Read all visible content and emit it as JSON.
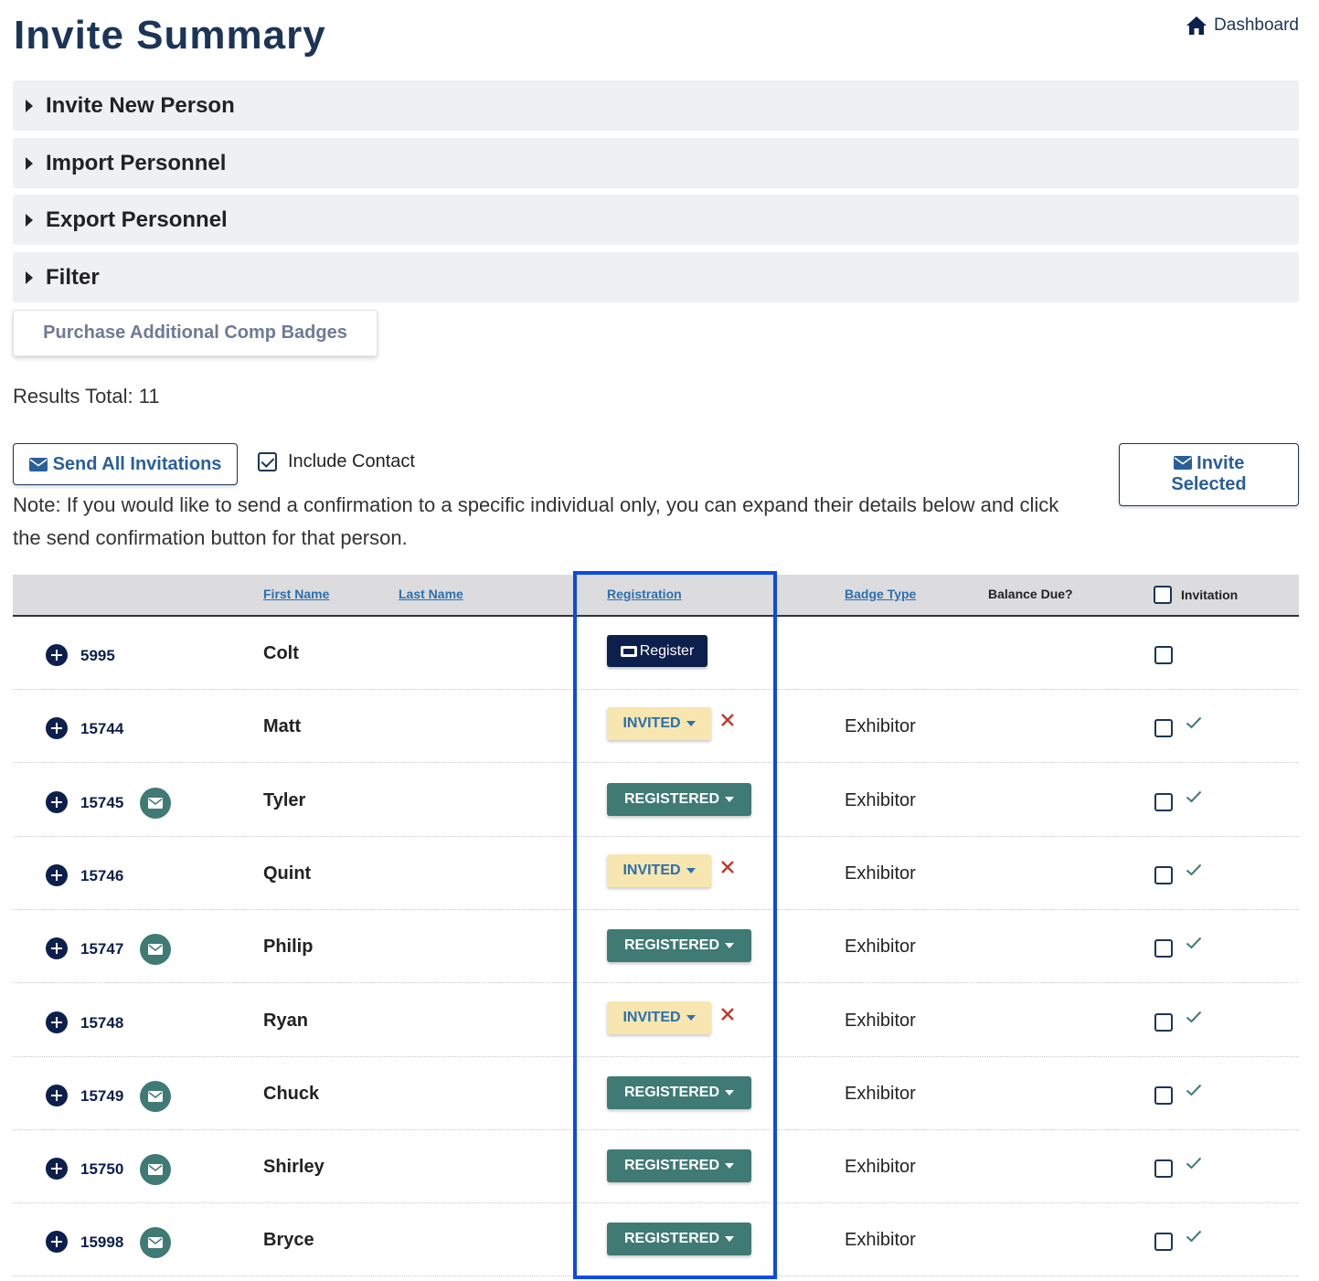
{
  "page": {
    "title": "Invite Summary"
  },
  "nav": {
    "dashboard_label": "Dashboard"
  },
  "accordions": [
    {
      "label": "Invite New Person"
    },
    {
      "label": "Import Personnel"
    },
    {
      "label": "Export Personnel"
    },
    {
      "label": "Filter"
    }
  ],
  "actions": {
    "purchase_label": "Purchase Additional Comp Badges",
    "results_label": "Results Total: 11",
    "send_all_label": "Send All Invitations",
    "include_contact_label": "Include Contact",
    "invite_selected_line1": "Invite",
    "invite_selected_line2": "Selected"
  },
  "note": "Note: If you would like to send a confirmation to a specific individual only, you can expand their details below and click the send confirmation button for that person.",
  "table": {
    "headers": {
      "first_name": "First Name",
      "last_name": "Last Name",
      "registration": "Registration",
      "badge_type": "Badge Type",
      "balance_due": "Balance Due?",
      "invitation": "Invitation"
    },
    "rows": [
      {
        "id": "5995",
        "first_name": "Colt",
        "status": "Register",
        "badge_type": "",
        "mail": false,
        "check": false
      },
      {
        "id": "15744",
        "first_name": "Matt",
        "status": "INVITED",
        "badge_type": "Exhibitor",
        "mail": false,
        "check": true
      },
      {
        "id": "15745",
        "first_name": "Tyler",
        "status": "REGISTERED",
        "badge_type": "Exhibitor",
        "mail": true,
        "check": true
      },
      {
        "id": "15746",
        "first_name": "Quint",
        "status": "INVITED",
        "badge_type": "Exhibitor",
        "mail": false,
        "check": true
      },
      {
        "id": "15747",
        "first_name": "Philip",
        "status": "REGISTERED",
        "badge_type": "Exhibitor",
        "mail": true,
        "check": true
      },
      {
        "id": "15748",
        "first_name": "Ryan",
        "status": "INVITED",
        "badge_type": "Exhibitor",
        "mail": false,
        "check": true
      },
      {
        "id": "15749",
        "first_name": "Chuck",
        "status": "REGISTERED",
        "badge_type": "Exhibitor",
        "mail": true,
        "check": true
      },
      {
        "id": "15750",
        "first_name": "Shirley",
        "status": "REGISTERED",
        "badge_type": "Exhibitor",
        "mail": true,
        "check": true
      },
      {
        "id": "15998",
        "first_name": "Bryce",
        "status": "REGISTERED",
        "badge_type": "Exhibitor",
        "mail": true,
        "check": true
      }
    ]
  },
  "colors": {
    "title": "#1c3557",
    "invited_bg": "#f8e6b0",
    "registered_bg": "#3f7a74",
    "register_bg": "#0c1f4d",
    "highlight": "#0b4be6"
  }
}
